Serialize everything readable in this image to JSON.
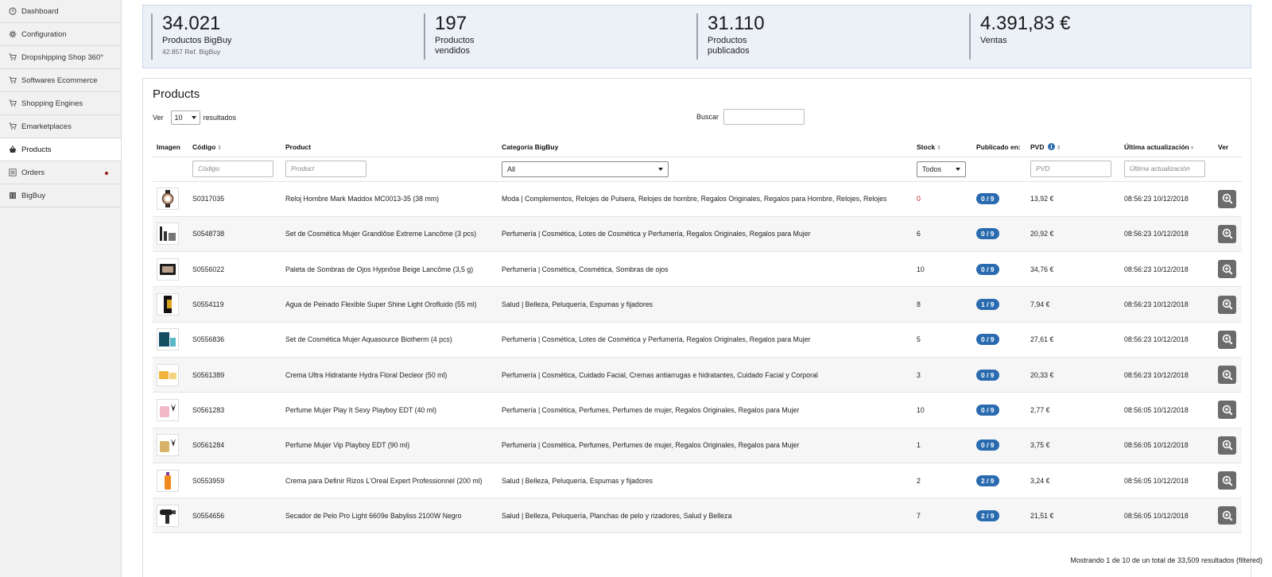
{
  "sidebar": {
    "items": [
      {
        "label": "Dashboard",
        "icon": "clock-icon",
        "active": false,
        "dot": false
      },
      {
        "label": "Configuration",
        "icon": "gear-icon",
        "active": false,
        "dot": false
      },
      {
        "label": "Dropshipping Shop 360°",
        "icon": "cart-icon",
        "active": false,
        "dot": false
      },
      {
        "label": "Softwares Ecommerce",
        "icon": "cart-icon",
        "active": false,
        "dot": false
      },
      {
        "label": "Shopping Engines",
        "icon": "cart-icon",
        "active": false,
        "dot": false
      },
      {
        "label": "Emarketplaces",
        "icon": "cart-icon",
        "active": false,
        "dot": false
      },
      {
        "label": "Products",
        "icon": "basket-icon",
        "active": true,
        "dot": false
      },
      {
        "label": "Orders",
        "icon": "list-icon",
        "active": false,
        "dot": true
      },
      {
        "label": "BigBuy",
        "icon": "building-icon",
        "active": false,
        "dot": false
      }
    ]
  },
  "stats": [
    {
      "value": "34.021",
      "label": "Productos BigBuy",
      "sub": "42.857 Ref. BigBuy"
    },
    {
      "value": "197",
      "label": "Productos vendidos",
      "sub": ""
    },
    {
      "value": "31.110",
      "label": "Productos publicados",
      "sub": ""
    },
    {
      "value": "4.391,83 €",
      "label": "Ventas",
      "sub": ""
    }
  ],
  "panel": {
    "title": "Products",
    "ver_label": "Ver",
    "ver_value": "10",
    "resultados_label": "resultados",
    "buscar_label": "Buscar"
  },
  "table": {
    "headers": {
      "imagen": "Imagen",
      "codigo": "Código",
      "product": "Product",
      "categoria": "Categoría BigBuy",
      "stock": "Stock",
      "publicado": "Publicado en:",
      "pvd": "PVD",
      "ultima": "Última actualización",
      "ver": "Ver"
    },
    "filters": {
      "codigo_placeholder": "Código",
      "product_placeholder": "Product",
      "categoria_value": "All",
      "stock_value": "Todos",
      "pvd_placeholder": "PVD",
      "ultima_placeholder": "Última actualización"
    },
    "rows": [
      {
        "code": "S0317035",
        "product": "Reloj Hombre Mark Maddox MC0013-35 (38 mm)",
        "category": "Moda | Complementos, Relojes de Pulsera, Relojes de hombre, Regalos Originales, Regalos para Hombre, Relojes, Relojes",
        "stock": "0",
        "published": "0 / 9",
        "pvd": "13,92 €",
        "updated": "08:56:23 10/12/2018"
      },
      {
        "code": "S0548738",
        "product": "Set de Cosmética Mujer Grandiôse Extreme Lancôme (3 pcs)",
        "category": "Perfumería | Cosmética, Lotes de Cosmética y Perfumería, Regalos Originales, Regalos para Mujer",
        "stock": "6",
        "published": "0 / 9",
        "pvd": "20,92 €",
        "updated": "08:56:23 10/12/2018"
      },
      {
        "code": "S0556022",
        "product": "Paleta de Sombras de Ojos Hypnôse Beige Lancôme (3,5 g)",
        "category": "Perfumería | Cosmética, Cosmética, Sombras de ojos",
        "stock": "10",
        "published": "0 / 9",
        "pvd": "34,76 €",
        "updated": "08:56:23 10/12/2018"
      },
      {
        "code": "S0554119",
        "product": "Agua de Peinado Flexible Super Shine Light Orofluido (55 ml)",
        "category": "Salud | Belleza, Peluquería, Espumas y fijadores",
        "stock": "8",
        "published": "1 / 9",
        "pvd": "7,94 €",
        "updated": "08:56:23 10/12/2018"
      },
      {
        "code": "S0556836",
        "product": "Set de Cosmética Mujer Aquasource Biotherm (4 pcs)",
        "category": "Perfumería | Cosmética, Lotes de Cosmética y Perfumería, Regalos Originales, Regalos para Mujer",
        "stock": "5",
        "published": "0 / 9",
        "pvd": "27,61 €",
        "updated": "08:56:23 10/12/2018"
      },
      {
        "code": "S0561389",
        "product": "Crema Ultra Hidratante Hydra Floral Decleor (50 ml)",
        "category": "Perfumería | Cosmética, Cuidado Facial, Cremas antiarrugas e hidratantes, Cuidado Facial y Corporal",
        "stock": "3",
        "published": "0 / 9",
        "pvd": "20,33 €",
        "updated": "08:56:23 10/12/2018"
      },
      {
        "code": "S0561283",
        "product": "Perfume Mujer Play It Sexy Playboy EDT (40 ml)",
        "category": "Perfumería | Cosmética, Perfumes, Perfumes de mujer, Regalos Originales, Regalos para Mujer",
        "stock": "10",
        "published": "0 / 9",
        "pvd": "2,77 €",
        "updated": "08:56:05 10/12/2018"
      },
      {
        "code": "S0561284",
        "product": "Perfume Mujer Vip Playboy EDT (90 ml)",
        "category": "Perfumería | Cosmética, Perfumes, Perfumes de mujer, Regalos Originales, Regalos para Mujer",
        "stock": "1",
        "published": "0 / 9",
        "pvd": "3,75 €",
        "updated": "08:56:05 10/12/2018"
      },
      {
        "code": "S0553959",
        "product": "Crema para Definir Rizos L'Oreal Expert Professionnel (200 ml)",
        "category": "Salud | Belleza, Peluquería, Espumas y fijadores",
        "stock": "2",
        "published": "2 / 9",
        "pvd": "3,24 €",
        "updated": "08:56:05 10/12/2018"
      },
      {
        "code": "S0554656",
        "product": "Secador de Pelo Pro Light 6609e Babyliss 2100W Negro",
        "category": "Salud | Belleza, Peluquería, Planchas de pelo y rizadores, Salud y Belleza",
        "stock": "7",
        "published": "2 / 9",
        "pvd": "21,51 €",
        "updated": "08:56:05 10/12/2018"
      }
    ]
  },
  "footer": {
    "text": "Mostrando 1 de 10 de un total de 33,509 resultados (filtered)"
  },
  "colors": {
    "badge": "#2a6bb0",
    "stock_zero": "#c21d1d",
    "stats_bg": "#ecf1f8",
    "view_button": "#6b6b6b"
  }
}
